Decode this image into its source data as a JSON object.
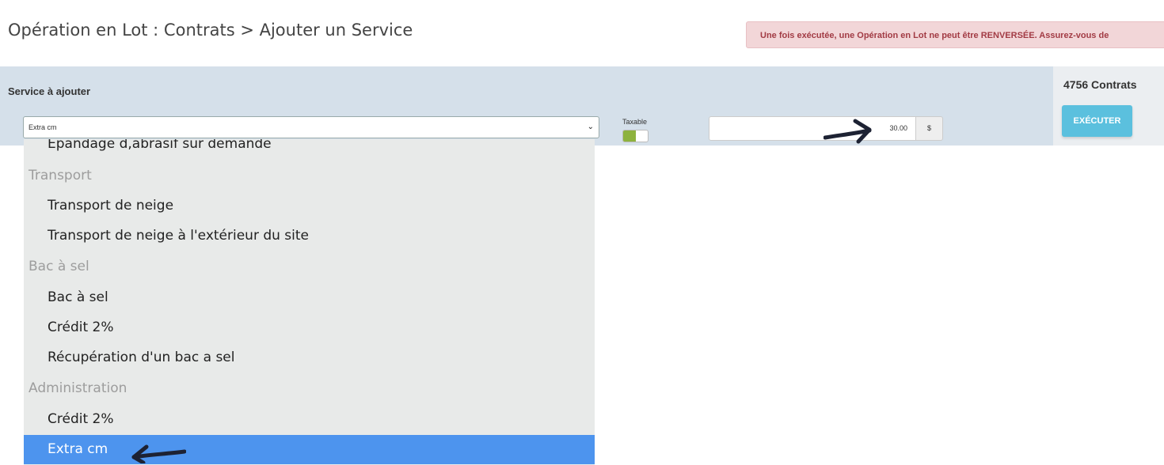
{
  "header": {
    "title": "Opération en Lot : Contrats > Ajouter un Service",
    "warning": "Une fois exécutée, une Opération en Lot ne peut être RENVERSÉE. Assurez-vous de"
  },
  "form": {
    "service_label": "Service à ajouter",
    "service_selected": "Extra cm",
    "taxable_label": "Taxable",
    "taxable_on": true,
    "price": "30.00",
    "currency": "$"
  },
  "side": {
    "contracts_count": "4756 Contrats",
    "execute_label": "EXÉCUTER"
  },
  "dropdown": {
    "items": [
      {
        "type": "option",
        "label": "Épandage d,abrasif sur demande"
      },
      {
        "type": "group",
        "label": "Transport"
      },
      {
        "type": "option",
        "label": "Transport de neige"
      },
      {
        "type": "option",
        "label": "Transport de neige à l'extérieur du site"
      },
      {
        "type": "group",
        "label": "Bac à sel"
      },
      {
        "type": "option",
        "label": "Bac à sel"
      },
      {
        "type": "option",
        "label": "Crédit 2%"
      },
      {
        "type": "option",
        "label": "Récupération d'un bac a sel"
      },
      {
        "type": "group",
        "label": "Administration"
      },
      {
        "type": "option",
        "label": "Crédit 2%"
      },
      {
        "type": "option",
        "label": "Extra cm",
        "selected": true
      }
    ]
  },
  "colors": {
    "panel_bg": "#d5e0ea",
    "warning_bg": "#f2d6d8",
    "warning_text": "#a23b44",
    "execute_bg": "#5bc0de",
    "selected_bg": "#4d94ee",
    "toggle_on": "#8db23e"
  },
  "icons": {
    "select_arrow": "chevron-down-icon",
    "annotation_arrows": [
      "arrow-right-icon",
      "arrow-left-icon"
    ]
  }
}
